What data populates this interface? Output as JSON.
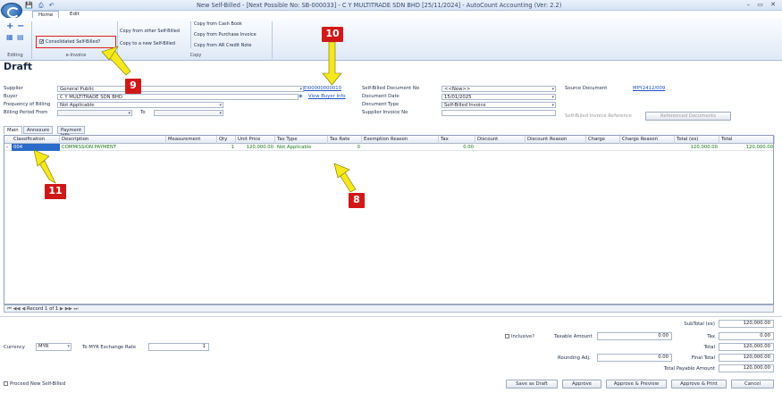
{
  "window": {
    "title": "New Self-Billed - [Next Possible No: SB-000033] - C Y MULTITRADE SDN BHD [25/11/2024] - AutoCount Accounting (Ver: 2.2)",
    "controls": "– ▭ ✕"
  },
  "ribbon": {
    "tabs": [
      "Home",
      "Edit"
    ],
    "editing_label": "Editing",
    "einvoice_label": "e-Invoice",
    "copy_label": "Copy",
    "consolidated_label": "Consolidated Self-Billed?",
    "copy_other": "Copy from other Self-Billed",
    "copy_new": "Copy to a new Self-Billed",
    "copy_cash": "Copy from Cash Book",
    "copy_purchase": "Copy from Purchase Invoice",
    "copy_arcn": "Copy from AR Credit Note"
  },
  "status": "Draft",
  "form": {
    "supplier_label": "Supplier",
    "supplier_value": "General Public",
    "supplier_code": "EI00000000010",
    "buyer_label": "Buyer",
    "buyer_value": "C Y MULTITRADE SDN BHD",
    "view_buyer": "View Buyer Info",
    "freq_label": "Frequency of Billing",
    "freq_value": "Not Applicable",
    "period_label": "Billing Period From",
    "to_label": "To",
    "docno_label": "Self-Billed Document No",
    "docno_value": "<<New>>",
    "docdate_label": "Document Date",
    "docdate_value": "15/01/2025",
    "doctype_label": "Document Type",
    "doctype_value": "Self-Billed Invoice",
    "supinv_label": "Supplier Invoice No",
    "source_label": "Source Document",
    "source_value": "MPY2412/009",
    "sbref_label": "Self-Billed Invoice Reference",
    "refdocs_button": "Referenced Documents"
  },
  "subtabs": [
    "Main",
    "Annexure",
    "Payment Info"
  ],
  "grid": {
    "headers": [
      "Classification",
      "Description",
      "Measurement",
      "Qty",
      "Unit Price",
      "Tax Type",
      "Tax Rate",
      "Exemption Reason",
      "Tax",
      "Discount",
      "Discount Reason",
      "Charge",
      "Charge Reason",
      "Total (ex)",
      "Total"
    ],
    "row": {
      "classification": "004",
      "description": "COMMISSION PAYMENT",
      "measurement": "",
      "qty": "1",
      "unit_price": "120,000.00",
      "tax_type": "Not Applicable",
      "tax_rate": "0",
      "exemption": "",
      "tax": "0.00",
      "discount": "",
      "discount_reason": "",
      "charge": "",
      "charge_reason": "",
      "total_ex": "120,000.00",
      "total": "120,000.00"
    },
    "nav_text": "Record 1 of 1"
  },
  "footer": {
    "currency_label": "Currency",
    "currency_value": "MYR",
    "rate_label": "To MYR Exchange Rate",
    "rate_value": "1",
    "inclusive_label": "Inclusive?",
    "taxable_label": "Taxable Amount",
    "taxable_value": "0.00",
    "rounding_label": "Rounding Adj.",
    "rounding_value": "0.00",
    "subtotal_label": "SubTotal (ex)",
    "subtotal_value": "120,000.00",
    "tax_label": "Tax",
    "tax_value": "0.00",
    "total_label": "Total",
    "total_value": "120,000.00",
    "final_label": "Final Total",
    "final_value": "120,000.00",
    "payable_label": "Total Payable Amount",
    "payable_value": "120,000.00",
    "proceed_label": "Proceed New Self-Billed",
    "buttons": [
      "Save as Draft",
      "Approve",
      "Approve & Preview",
      "Approve & Print",
      "Cancel"
    ]
  },
  "annotations": [
    "10",
    "9",
    "8",
    "11"
  ],
  "colors": {
    "arrow": "#f5e81c",
    "badge": "#d01818",
    "grid_text": "#1a7a1a",
    "link": "#1a4fbf"
  }
}
